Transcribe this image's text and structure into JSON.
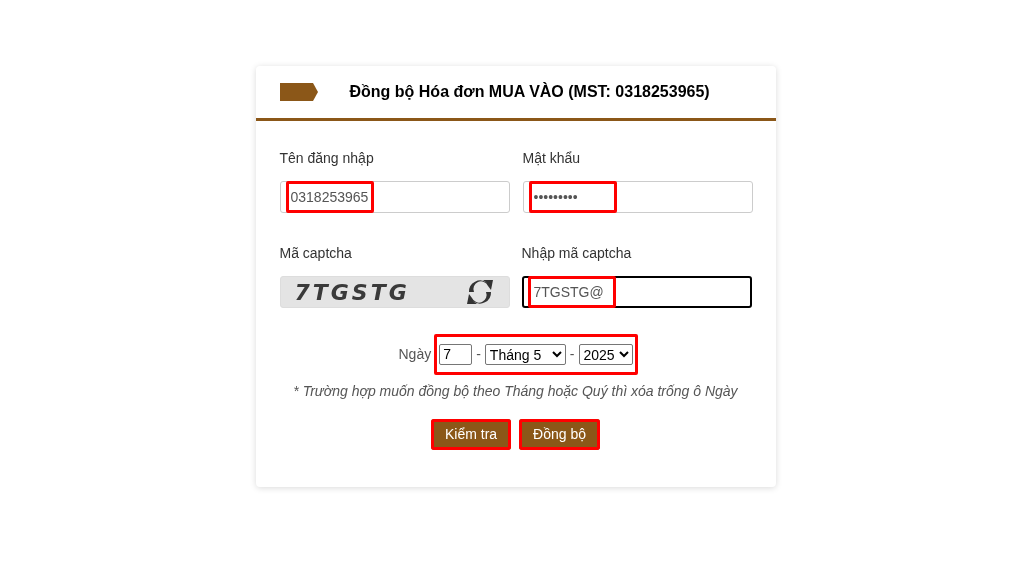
{
  "title": "Đồng bộ Hóa đơn MUA VÀO (MST: 0318253965)",
  "fields": [
    {
      "label": "Tên đăng nhập",
      "value": "0318253965",
      "highlighted": true,
      "focused": false
    },
    {
      "label": "Mật khẩu",
      "value": "•••••••••",
      "highlighted": true,
      "focused": false
    }
  ],
  "captcha": {
    "label": "Mã captcha",
    "text": "7TGSTG"
  },
  "captcha_input": {
    "label": "Nhập mã captcha",
    "value": "7TGSTG@",
    "highlighted": true,
    "focused": true
  },
  "date": {
    "label": "Ngày",
    "day": "7",
    "separator_1": "-",
    "month": "Tháng 5",
    "separator_2": "-",
    "year": "2025",
    "highlighted": true
  },
  "note": "* Trường hợp muốn đồng bộ theo Tháng hoặc Quý thì xóa trống ô Ngày",
  "buttons": [
    {
      "label": "Kiểm tra",
      "highlighted": true
    },
    {
      "label": "Đồng bộ",
      "highlighted": true
    }
  ]
}
